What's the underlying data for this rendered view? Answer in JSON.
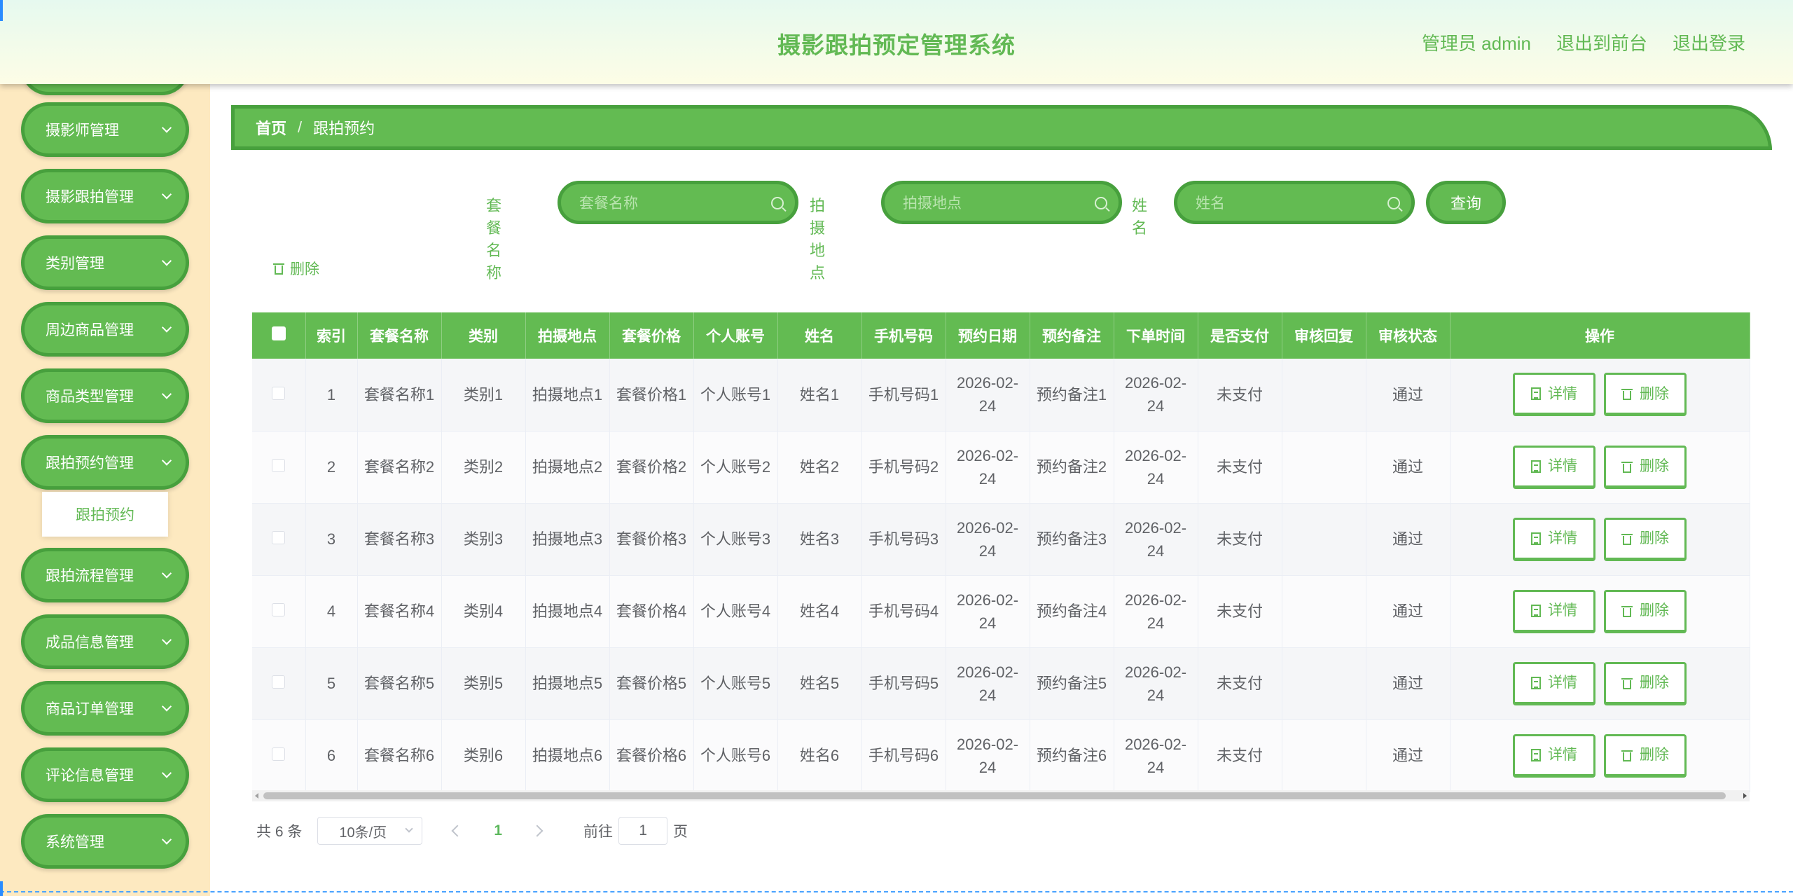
{
  "header": {
    "title": "摄影跟拍预定管理系统",
    "admin": "管理员 admin",
    "to_front": "退出到前台",
    "logout": "退出登录"
  },
  "sidebar": {
    "items": [
      {
        "label": "摄影师管理"
      },
      {
        "label": "摄影跟拍管理"
      },
      {
        "label": "类别管理"
      },
      {
        "label": "周边商品管理"
      },
      {
        "label": "商品类型管理"
      },
      {
        "label": "跟拍预约管理"
      },
      {
        "label": "跟拍流程管理"
      },
      {
        "label": "成品信息管理"
      },
      {
        "label": "商品订单管理"
      },
      {
        "label": "评论信息管理"
      },
      {
        "label": "系统管理"
      }
    ],
    "sub_item": "跟拍预约"
  },
  "breadcrumb": {
    "home": "首页",
    "sep": "/",
    "current": "跟拍预约"
  },
  "search": {
    "package_label": "套餐名称",
    "package_placeholder": "套餐名称",
    "location_label": "拍摄地点",
    "location_placeholder": "拍摄地点",
    "name_label": "姓名",
    "name_placeholder": "姓名",
    "query": "查询"
  },
  "toolbar": {
    "delete": "删除"
  },
  "table": {
    "headers": [
      "索引",
      "套餐名称",
      "类别",
      "拍摄地点",
      "套餐价格",
      "个人账号",
      "姓名",
      "手机号码",
      "预约日期",
      "预约备注",
      "下单时间",
      "是否支付",
      "审核回复",
      "审核状态",
      "操作"
    ],
    "detail_label": "详情",
    "delete_label": "删除",
    "rows": [
      {
        "idx": "1",
        "pkg": "套餐名称1",
        "cat": "类别1",
        "loc": "拍摄地点1",
        "price": "套餐价格1",
        "acct": "个人账号1",
        "name": "姓名1",
        "phone": "手机号码1",
        "date": "2026-02-24",
        "note": "预约备注1",
        "time": "2026-02-24",
        "paid": "未支付",
        "reply": "",
        "status": "通过"
      },
      {
        "idx": "2",
        "pkg": "套餐名称2",
        "cat": "类别2",
        "loc": "拍摄地点2",
        "price": "套餐价格2",
        "acct": "个人账号2",
        "name": "姓名2",
        "phone": "手机号码2",
        "date": "2026-02-24",
        "note": "预约备注2",
        "time": "2026-02-24",
        "paid": "未支付",
        "reply": "",
        "status": "通过"
      },
      {
        "idx": "3",
        "pkg": "套餐名称3",
        "cat": "类别3",
        "loc": "拍摄地点3",
        "price": "套餐价格3",
        "acct": "个人账号3",
        "name": "姓名3",
        "phone": "手机号码3",
        "date": "2026-02-24",
        "note": "预约备注3",
        "time": "2026-02-24",
        "paid": "未支付",
        "reply": "",
        "status": "通过"
      },
      {
        "idx": "4",
        "pkg": "套餐名称4",
        "cat": "类别4",
        "loc": "拍摄地点4",
        "price": "套餐价格4",
        "acct": "个人账号4",
        "name": "姓名4",
        "phone": "手机号码4",
        "date": "2026-02-24",
        "note": "预约备注4",
        "time": "2026-02-24",
        "paid": "未支付",
        "reply": "",
        "status": "通过"
      },
      {
        "idx": "5",
        "pkg": "套餐名称5",
        "cat": "类别5",
        "loc": "拍摄地点5",
        "price": "套餐价格5",
        "acct": "个人账号5",
        "name": "姓名5",
        "phone": "手机号码5",
        "date": "2026-02-24",
        "note": "预约备注5",
        "time": "2026-02-24",
        "paid": "未支付",
        "reply": "",
        "status": "通过"
      },
      {
        "idx": "6",
        "pkg": "套餐名称6",
        "cat": "类别6",
        "loc": "拍摄地点6",
        "price": "套餐价格6",
        "acct": "个人账号6",
        "name": "姓名6",
        "phone": "手机号码6",
        "date": "2026-02-24",
        "note": "预约备注6",
        "time": "2026-02-24",
        "paid": "未支付",
        "reply": "",
        "status": "通过"
      }
    ]
  },
  "pagination": {
    "total": "共 6 条",
    "page_size": "10条/页",
    "current": "1",
    "goto_prefix": "前往",
    "goto_value": "1",
    "goto_suffix": "页"
  },
  "colors": {
    "accent": "#63bb52",
    "accent_border": "#47a03d",
    "sidebar_bg": "#fde9c0",
    "text_green": "#62b954"
  }
}
